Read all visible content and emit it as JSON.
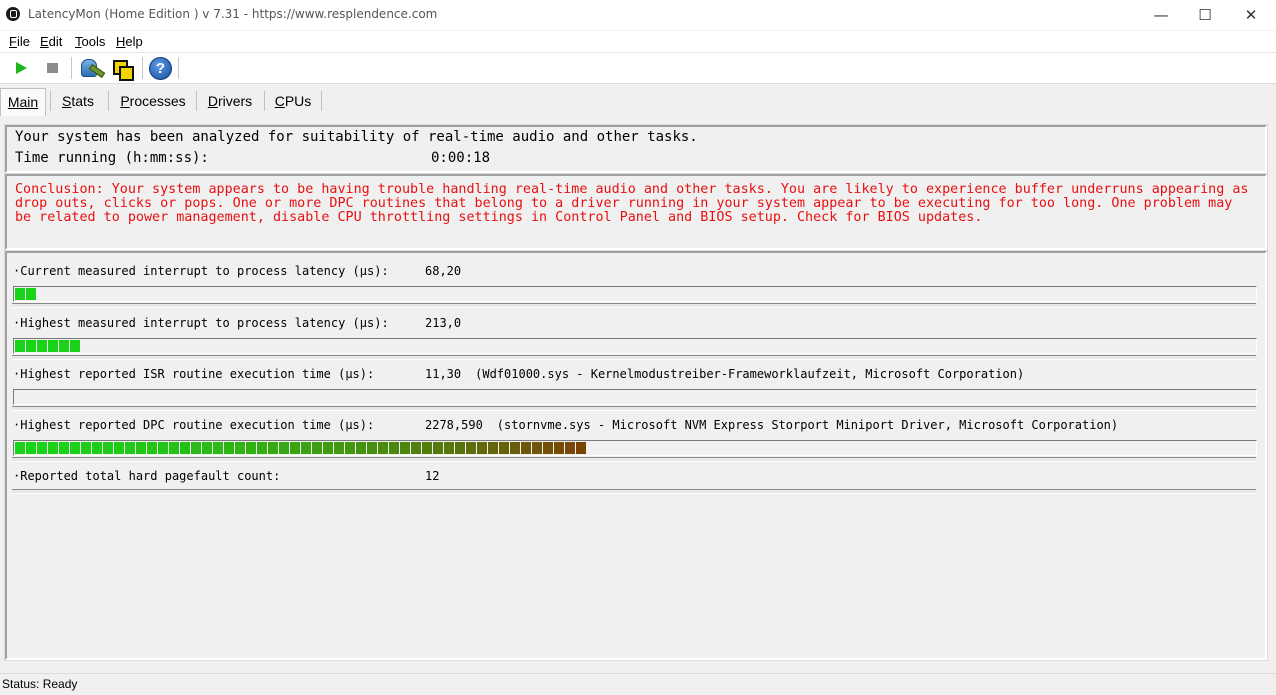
{
  "window": {
    "title": "LatencyMon  (Home Edition )  v 7.31 - https://www.resplendence.com",
    "min_symbol": "—",
    "max_symbol": "☐",
    "close_symbol": "✕"
  },
  "menu": [
    {
      "mnemonic": "F",
      "rest": "ile"
    },
    {
      "mnemonic": "E",
      "rest": "dit"
    },
    {
      "mnemonic": "T",
      "rest": "ools"
    },
    {
      "mnemonic": "H",
      "rest": "elp"
    }
  ],
  "toolbar": {
    "buttons": [
      "play-icon",
      "stop-icon",
      "analyze-icon",
      "windows-icon",
      "help-icon"
    ],
    "help_glyph": "?"
  },
  "tabs": {
    "main": {
      "mnemonic": "M",
      "rest": "ain"
    },
    "stats": {
      "mnemonic": "S",
      "rest": "tats"
    },
    "processes": {
      "mnemonic": "P",
      "rest": "rocesses"
    },
    "drivers": {
      "mnemonic": "D",
      "rest": "rivers"
    },
    "cpus": {
      "mnemonic": "C",
      "rest": "PUs"
    }
  },
  "summary": {
    "analyzed": "Your system has been analyzed for suitability of real-time audio and other tasks.",
    "time_label": "Time running (h:mm:ss):",
    "time_value": "0:00:18"
  },
  "conclusion": "Conclusion: Your system appears to be having trouble handling real-time audio and other tasks. You are likely to experience buffer underruns appearing as drop outs, clicks or pops. One or more DPC routines that belong to a driver running in your system appear to be executing for too long. One problem may be related to power management, disable CPU throttling settings in Control Panel and BIOS setup. Check for BIOS updates.",
  "measurements": [
    {
      "label": "·Current measured interrupt to process latency (µs):",
      "value": "68,20",
      "extra": "",
      "bar_segments": 2
    },
    {
      "label": "·Highest measured interrupt to process latency (µs):",
      "value": "213,0",
      "extra": "",
      "bar_segments": 6
    },
    {
      "label": "·Highest reported ISR routine execution time (µs):",
      "value": "11,30",
      "extra": "(Wdf01000.sys - Kernelmodustreiber-Frameworklaufzeit, Microsoft Corporation)",
      "bar_segments": 0
    },
    {
      "label": "·Highest reported DPC routine execution time (µs):",
      "value": "2278,590",
      "extra": "(stornvme.sys - Microsoft NVM Express Storport Miniport Driver, Microsoft Corporation)",
      "bar_segments": 52
    },
    {
      "label": "·Reported total hard pagefault count:",
      "value": "12",
      "extra": "",
      "bar_segments": null
    }
  ],
  "colors": {
    "conclusion": "#e81010",
    "bar_start": "#18d418",
    "bar_end": "#7a4306"
  },
  "status": "Status: Ready"
}
